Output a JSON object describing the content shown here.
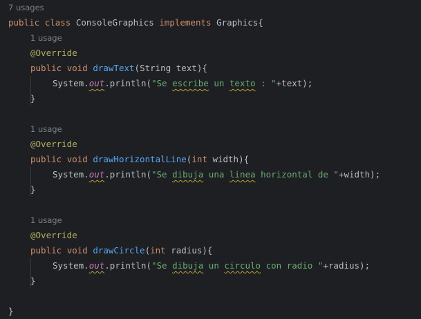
{
  "class_usages": "7 usages",
  "class_decl": {
    "kw_public": "public",
    "kw_class": "class",
    "class_name": "ConsoleGraphics",
    "kw_implements": "implements",
    "iface_name": "Graphics",
    "open_brace": "{"
  },
  "methods": [
    {
      "usages": "1 usage",
      "annotation": "@Override",
      "kw_public": "public",
      "kw_void": "void",
      "name": "drawText",
      "param_type": "String",
      "param_type_is_keyword": false,
      "param_name": "text",
      "sig_close": "){",
      "system": "System.",
      "out": "out",
      "println": ".println(",
      "string_parts": [
        "\"Se ",
        "escribe",
        " un ",
        "texto",
        " : \""
      ],
      "string_squiggle": [
        false,
        true,
        false,
        true,
        false
      ],
      "tail": "+text);",
      "close_brace": "}"
    },
    {
      "usages": "1 usage",
      "annotation": "@Override",
      "kw_public": "public",
      "kw_void": "void",
      "name": "drawHorizontalLine",
      "param_type": "int",
      "param_type_is_keyword": true,
      "param_name": "width",
      "sig_close": "){",
      "system": "System.",
      "out": "out",
      "println": ".println(",
      "string_parts": [
        "\"Se ",
        "dibuja",
        " una ",
        "linea",
        " horizontal de \""
      ],
      "string_squiggle": [
        false,
        true,
        false,
        true,
        false
      ],
      "tail": "+width);",
      "close_brace": "}"
    },
    {
      "usages": "1 usage",
      "annotation": "@Override",
      "kw_public": "public",
      "kw_void": "void",
      "name": "drawCircle",
      "param_type": "int",
      "param_type_is_keyword": true,
      "param_name": "radius",
      "sig_close": "){",
      "system": "System.",
      "out": "out",
      "println": ".println(",
      "string_parts": [
        "\"Se ",
        "dibuja",
        " un ",
        "circulo",
        " con radio \""
      ],
      "string_squiggle": [
        false,
        true,
        false,
        true,
        false
      ],
      "tail": "+radius);",
      "close_brace": "}"
    }
  ],
  "class_close": "}",
  "colors": {
    "background": "#1e1f22",
    "keyword": "#cf8e6d",
    "annotation": "#b3ae60",
    "method_name": "#56a8f5",
    "string": "#6aab73",
    "static_field": "#c77dbb",
    "plain": "#bcbec4",
    "inlay_hint": "#7d8088",
    "typo_squiggle": "#b5a33a"
  }
}
